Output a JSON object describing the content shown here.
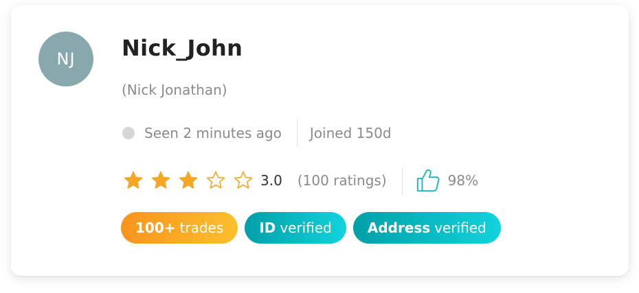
{
  "profile": {
    "initials": "NJ",
    "username": "Nick_John",
    "full_name": "(Nick Jonathan)",
    "avatar_color": "#87a9ad"
  },
  "status": {
    "seen_text": "Seen 2 minutes ago",
    "joined_text": "Joined 150d",
    "presence_color": "#d6d6d6"
  },
  "rating": {
    "stars_filled": 3,
    "stars_total": 5,
    "value": "3.0",
    "count_text": "(100 ratings)",
    "approval": "98%",
    "star_color": "#f5a623",
    "thumb_color": "#1fb5c0"
  },
  "badges": {
    "trades": {
      "bold": "100+",
      "text": "trades"
    },
    "id": {
      "bold": "ID",
      "text": "verified"
    },
    "address": {
      "bold": "Address",
      "text": "verified"
    }
  },
  "colors": {
    "trades_gradient": [
      "#f7941d",
      "#fbc02d"
    ],
    "teal_gradient": [
      "#00a0a8",
      "#12d3dc"
    ]
  }
}
